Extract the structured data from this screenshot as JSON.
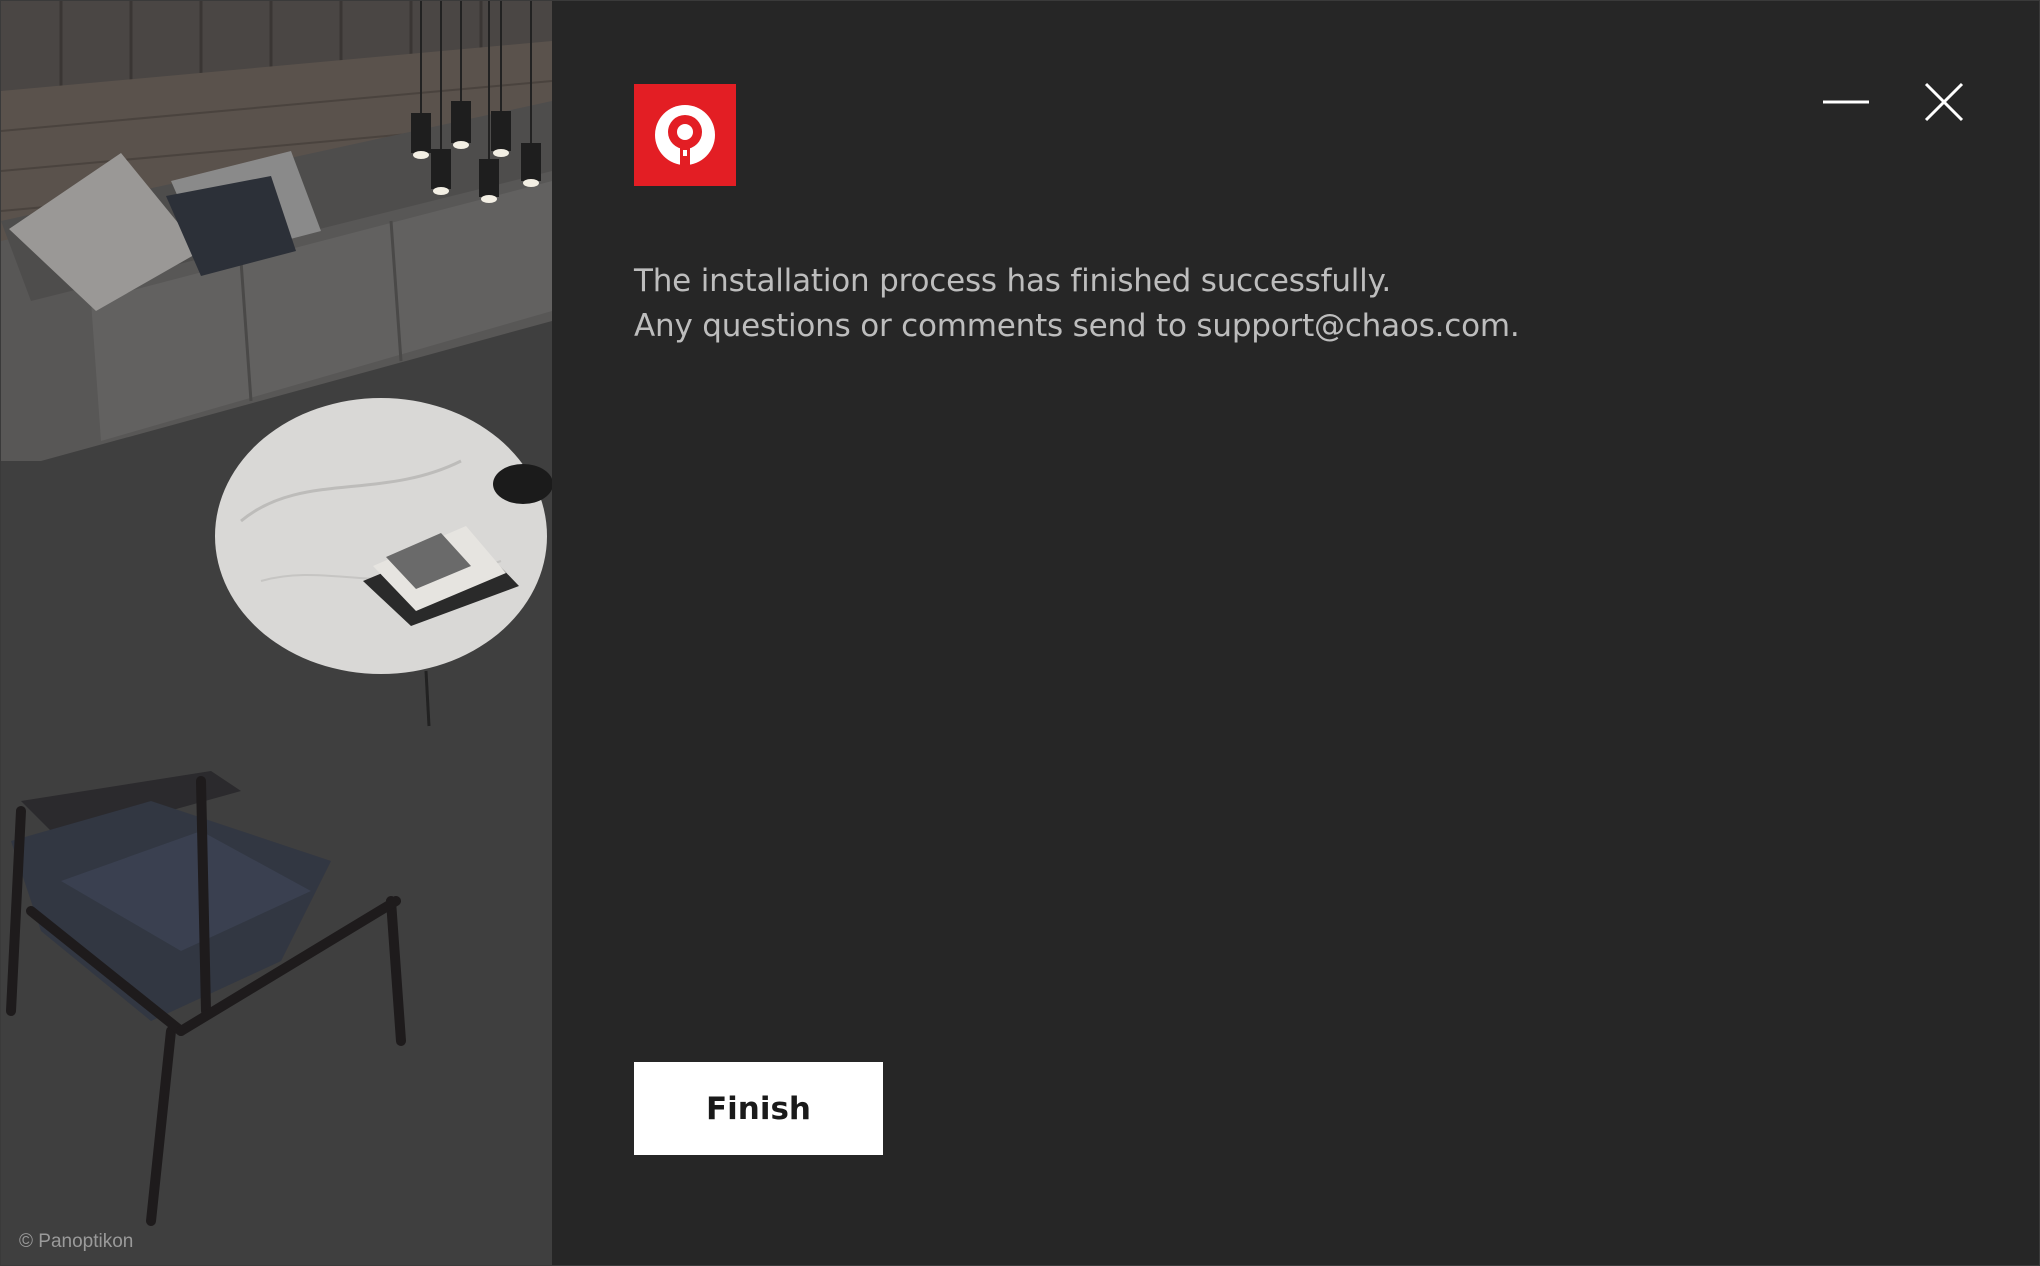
{
  "window": {
    "minimize_icon": "minimize-icon",
    "close_icon": "close-icon"
  },
  "side_image": {
    "credit": "© Panoptikon"
  },
  "logo": {
    "icon": "chaos-logo-icon",
    "color": "#e31e24"
  },
  "message": {
    "line1": "The installation process has finished successfully.",
    "line2": "Any questions or comments send to support@chaos.com."
  },
  "actions": {
    "finish_label": "Finish"
  }
}
